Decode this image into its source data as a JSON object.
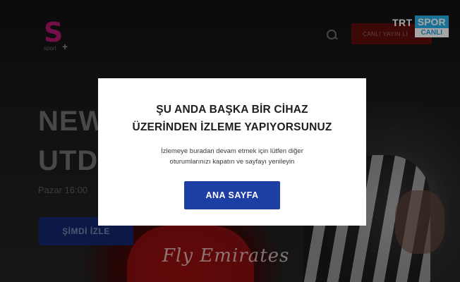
{
  "nav": {
    "logo_sub": "sport",
    "logo_plus": "+",
    "live_button_label": "CANLI YAYIN LI",
    "broadcaster": {
      "name": "TRT",
      "channel": "SPOR",
      "live_tag": "CANLI"
    }
  },
  "hero": {
    "title_line1": "NEW",
    "title_line2": "UTD",
    "date": "Pazar 16:00",
    "watch_button": "ŞİMDİ İZLE",
    "jersey_text": "Fly Emirates"
  },
  "modal": {
    "title_line1": "ŞU ANDA BAŞKA BİR CİHAZ",
    "title_line2": "ÜZERİNDEN İZLEME YAPIYORSUNUZ",
    "message_line1": "İzlemeye buradan devam etmek için lütfen diğer",
    "message_line2": "oturumlarınızı kapatın ve sayfayı yenileyin",
    "home_button": "ANA SAYFA"
  },
  "colors": {
    "modal_bg": "#ffffff",
    "primary_button": "#1d3ea3",
    "live_button": "#5c0d0d",
    "brand_accent": "#b3166f",
    "trt_spor_blue": "#27aee7"
  }
}
